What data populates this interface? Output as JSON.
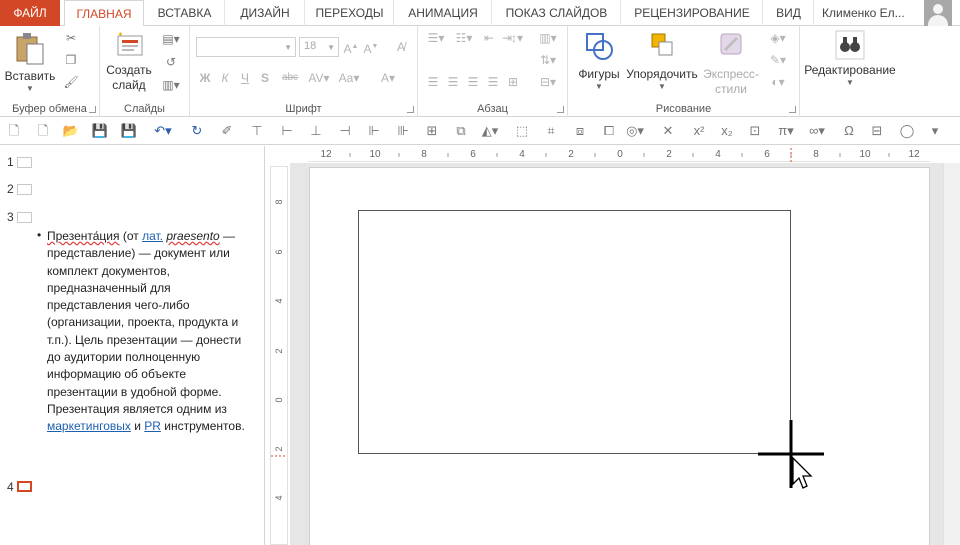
{
  "tabs": [
    {
      "label": "ФАЙЛ"
    },
    {
      "label": "ГЛАВНАЯ"
    },
    {
      "label": "ВСТАВКА"
    },
    {
      "label": "ДИЗАЙН"
    },
    {
      "label": "ПЕРЕХОДЫ"
    },
    {
      "label": "АНИМАЦИЯ"
    },
    {
      "label": "ПОКАЗ СЛАЙДОВ"
    },
    {
      "label": "РЕЦЕНЗИРОВАНИЕ"
    },
    {
      "label": "ВИД"
    }
  ],
  "user": {
    "name": "Клименко Ел..."
  },
  "ribbon": {
    "clipboard": {
      "label": "Буфер обмена",
      "paste": "Вставить"
    },
    "slides": {
      "label": "Слайды",
      "create_line1": "Создать",
      "create_line2": "слайд"
    },
    "font": {
      "label": "Шрифт",
      "size": "18",
      "bold": "Ж",
      "italic": "К",
      "underline": "Ч",
      "shadow": "S",
      "strike": "abc"
    },
    "paragraph": {
      "label": "Абзац"
    },
    "drawing": {
      "label": "Рисование",
      "shapes": "Фигуры",
      "arrange": "Упорядочить",
      "styles_line1": "Экспресс-",
      "styles_line2": "стили"
    },
    "editing": {
      "label": "Редактирование"
    }
  },
  "outline": {
    "slides": [
      {
        "number": "1"
      },
      {
        "number": "2"
      },
      {
        "number": "3"
      },
      {
        "number": "4"
      }
    ],
    "text": {
      "t1": "Презента́ция",
      "t2": " (от ",
      "t3": "лат.",
      "t4": " ",
      "t5": "praesento",
      "t6": " — представление) — документ или комплект документов, предназначенный для представления чего-либо (организации, проекта, продукта и т.п.). Цель презентации — донести до аудитории полноценную информацию об объекте презентации в удобной форме. Презентация является одним из ",
      "t7": "маркетинговых",
      "t8": " и ",
      "t9": "PR",
      "t10": " инструментов."
    }
  },
  "hruler": {
    "ticks": [
      "12",
      "10",
      "8",
      "6",
      "4",
      "2",
      "0",
      "2",
      "4",
      "6",
      "8",
      "10",
      "12"
    ]
  },
  "vruler": {
    "ticks": [
      "8",
      "6",
      "4",
      "2",
      "0",
      "2",
      "4"
    ]
  },
  "colors": {
    "accent": "#d24726",
    "link": "#1f5fb0"
  }
}
